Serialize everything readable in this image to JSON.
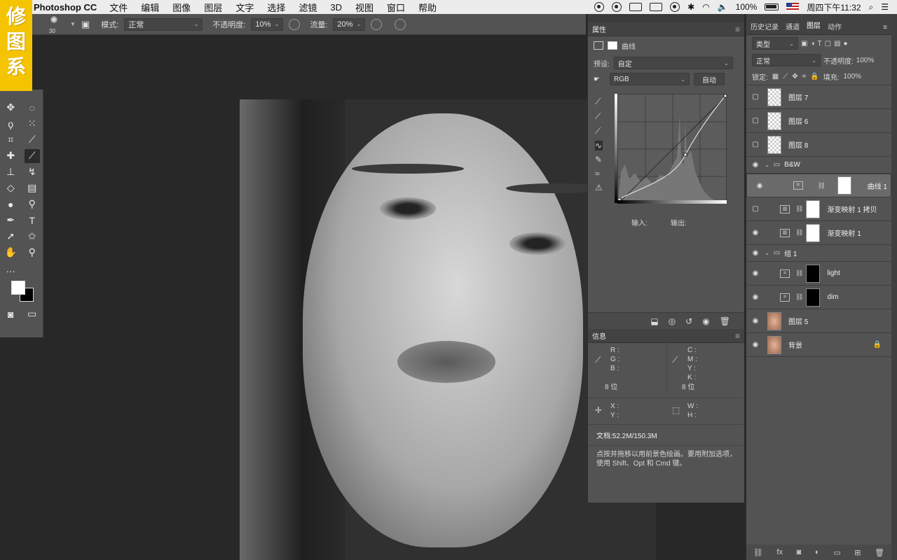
{
  "menubar": {
    "app": "Photoshop CC",
    "items": [
      "文件",
      "编辑",
      "图像",
      "图层",
      "文字",
      "选择",
      "滤镜",
      "3D",
      "视图",
      "窗口",
      "帮助"
    ],
    "battery": "100%",
    "clock": "周四下午11:32"
  },
  "logo": {
    "text": "修图系"
  },
  "options": {
    "brush_size": "30",
    "mode_label": "模式:",
    "mode_value": "正常",
    "opacity_label": "不透明度:",
    "opacity_value": "10%",
    "flow_label": "流量:",
    "flow_value": "20%"
  },
  "properties": {
    "tab": "属性",
    "panel_name": "曲线",
    "preset_label": "预设:",
    "preset_value": "自定",
    "channel": "RGB",
    "auto_button": "自动",
    "input_label": "输入:",
    "output_label": "输出:"
  },
  "info": {
    "tab": "信息",
    "rgb": [
      "R :",
      "G :",
      "B :"
    ],
    "cmyk": [
      "C :",
      "M :",
      "Y :",
      "K :"
    ],
    "bits_left": "8 位",
    "bits_right": "8 位",
    "xy": [
      "X :",
      "Y :"
    ],
    "wh": [
      "W :",
      "H :"
    ],
    "doc": "文档:52.2M/150.3M",
    "hint": "点按并拖移以用前景色绘画。要用附加选项，使用 Shift、Opt 和 Cmd 键。"
  },
  "layers_panel": {
    "tabs": [
      "历史记录",
      "通道",
      "图层",
      "动作"
    ],
    "filter": "类型",
    "blend": "正常",
    "opacity_label": "不透明度:",
    "opacity_value": "100%",
    "lock_label": "锁定:",
    "fill_label": "填充:",
    "fill_value": "100%",
    "layers": [
      {
        "name": "图层 7",
        "visible": false,
        "kind": "pixel"
      },
      {
        "name": "图层 6",
        "visible": false,
        "kind": "pixel"
      },
      {
        "name": "图层 8",
        "visible": false,
        "kind": "pixel"
      },
      {
        "name": "B&W",
        "visible": true,
        "kind": "group"
      },
      {
        "name": "曲线 1",
        "visible": true,
        "kind": "curves",
        "selected": true
      },
      {
        "name": "渐变映射 1 拷贝",
        "visible": false,
        "kind": "gradient"
      },
      {
        "name": "渐变映射 1",
        "visible": true,
        "kind": "gradient"
      },
      {
        "name": "组 1",
        "visible": true,
        "kind": "group"
      },
      {
        "name": "light",
        "visible": true,
        "kind": "curves-black"
      },
      {
        "name": "dim",
        "visible": true,
        "kind": "curves-black"
      },
      {
        "name": "图层 5",
        "visible": true,
        "kind": "photo"
      },
      {
        "name": "背景",
        "visible": true,
        "kind": "photo-locked"
      }
    ]
  }
}
